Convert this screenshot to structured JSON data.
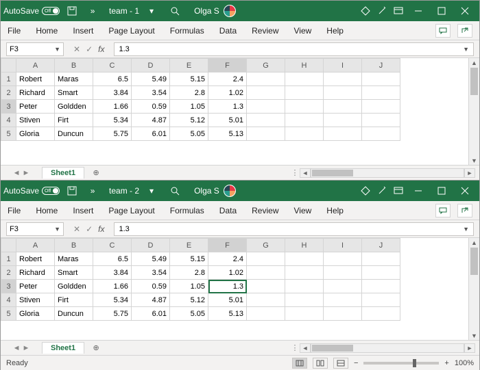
{
  "windows": [
    {
      "autosave_label": "AutoSave",
      "autosave_state": "Off",
      "doc_title": "team - 1",
      "search_visible": true,
      "user_name": "Olga S",
      "name_box": "F3",
      "formula_value": "1.3",
      "ribbon": [
        "File",
        "Home",
        "Insert",
        "Page Layout",
        "Formulas",
        "Data",
        "Review",
        "View",
        "Help"
      ],
      "columns": [
        "A",
        "B",
        "C",
        "D",
        "E",
        "F",
        "G",
        "H",
        "I",
        "J"
      ],
      "selected_cell": {
        "row": 3,
        "col": "F"
      },
      "rows": [
        {
          "n": 1,
          "A": "Robert",
          "B": "Maras",
          "C": 6.5,
          "D": 5.49,
          "E": 5.15,
          "F": 2.4
        },
        {
          "n": 2,
          "A": "Richard",
          "B": "Smart",
          "C": 3.84,
          "D": 3.54,
          "E": 2.8,
          "F": 1.02
        },
        {
          "n": 3,
          "A": "Peter",
          "B": "Goldden",
          "C": 1.66,
          "D": 0.59,
          "E": 1.05,
          "F": 1.3
        },
        {
          "n": 4,
          "A": "Stiven",
          "B": "Firt",
          "C": 5.34,
          "D": 4.87,
          "E": 5.12,
          "F": 5.01
        },
        {
          "n": 5,
          "A": "Gloria",
          "B": "Duncun",
          "C": 5.75,
          "D": 6.01,
          "E": 5.05,
          "F": 5.13
        }
      ],
      "sheet_tab": "Sheet1"
    },
    {
      "autosave_label": "AutoSave",
      "autosave_state": "Off",
      "doc_title": "team - 2",
      "search_visible": true,
      "user_name": "Olga S",
      "name_box": "F3",
      "formula_value": "1.3",
      "ribbon": [
        "File",
        "Home",
        "Insert",
        "Page Layout",
        "Formulas",
        "Data",
        "Review",
        "View",
        "Help"
      ],
      "columns": [
        "A",
        "B",
        "C",
        "D",
        "E",
        "F",
        "G",
        "H",
        "I",
        "J"
      ],
      "selected_cell": {
        "row": 3,
        "col": "F"
      },
      "rows": [
        {
          "n": 1,
          "A": "Robert",
          "B": "Maras",
          "C": 6.5,
          "D": 5.49,
          "E": 5.15,
          "F": 2.4
        },
        {
          "n": 2,
          "A": "Richard",
          "B": "Smart",
          "C": 3.84,
          "D": 3.54,
          "E": 2.8,
          "F": 1.02
        },
        {
          "n": 3,
          "A": "Peter",
          "B": "Goldden",
          "C": 1.66,
          "D": 0.59,
          "E": 1.05,
          "F": 1.3
        },
        {
          "n": 4,
          "A": "Stiven",
          "B": "Firt",
          "C": 5.34,
          "D": 4.87,
          "E": 5.12,
          "F": 5.01
        },
        {
          "n": 5,
          "A": "Gloria",
          "B": "Duncun",
          "C": 5.75,
          "D": 6.01,
          "E": 5.05,
          "F": 5.13
        }
      ],
      "sheet_tab": "Sheet1",
      "status_text": "Ready",
      "zoom": "100%"
    }
  ]
}
